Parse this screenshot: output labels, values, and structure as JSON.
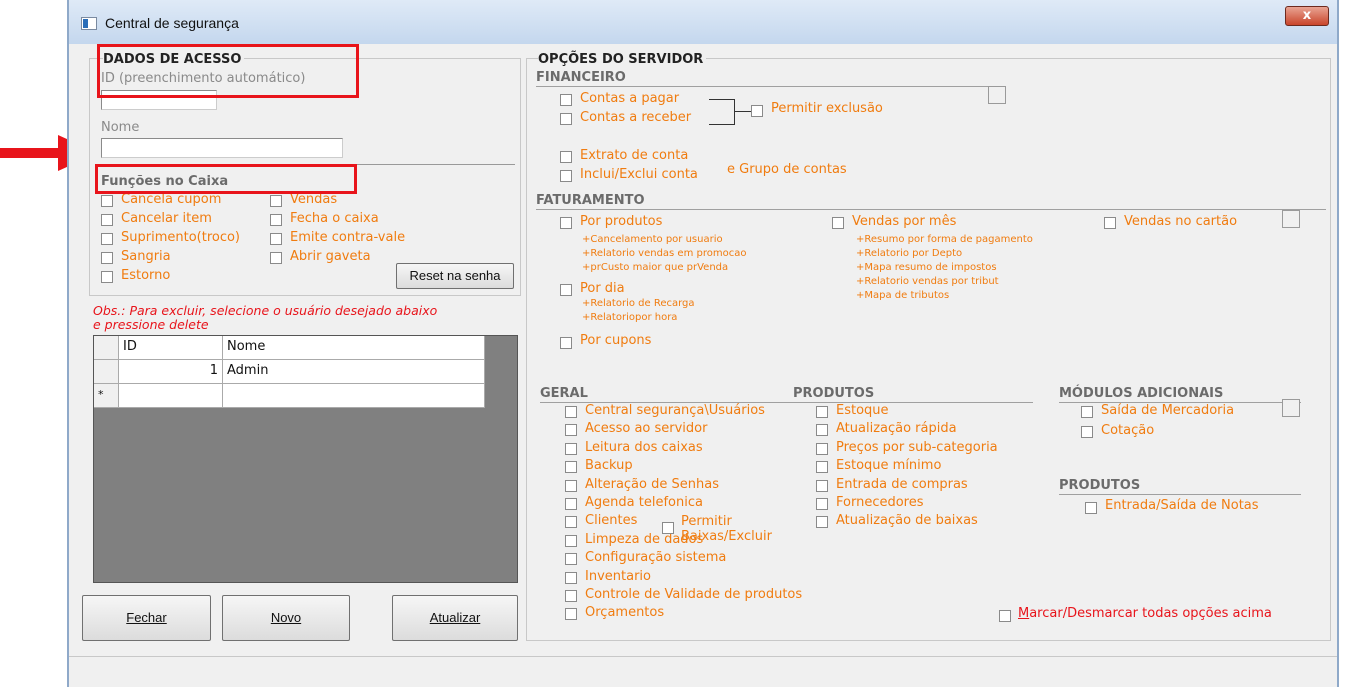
{
  "window": {
    "title": "Central de segurança",
    "close_label": "x"
  },
  "access": {
    "header": "DADOS DE ACESSO",
    "id_label": "ID (preenchimento automático)",
    "id_value": "",
    "name_label": "Nome",
    "name_value": "",
    "funcs_header": "Funções no Caixa",
    "left_items": [
      "Cancela cupom",
      "Cancelar item",
      "Suprimento(troco)",
      "Sangria",
      "Estorno"
    ],
    "right_items": [
      "Vendas",
      "Fecha o caixa",
      "Emite contra-vale",
      "Abrir gaveta"
    ],
    "reset_button": "Reset na senha",
    "obs_text_1": "Obs.: Para excluir, selecione o usuário desejado abaixo",
    "obs_text_2": "e pressione delete"
  },
  "users_table": {
    "columns": [
      "ID",
      "Nome"
    ],
    "rows": [
      {
        "id": "1",
        "nome": "Admin"
      }
    ],
    "new_row_marker": "*"
  },
  "buttons": {
    "close": "Fechar",
    "new": "Novo",
    "update": "Atualizar"
  },
  "server": {
    "header": "OPÇÕES DO SERVIDOR",
    "financeiro": {
      "title": "FINANCEIRO",
      "pagar": "Contas a pagar",
      "receber": "Contas a receber",
      "permitir": "Permitir exclusão",
      "extrato": "Extrato de conta",
      "inclui": "Inclui/Exclui conta",
      "grupo": "e Grupo de contas"
    },
    "faturamento": {
      "title": "FATURAMENTO",
      "por_produtos": "Por produtos",
      "por_produtos_sub": [
        "+Cancelamento por usuario",
        "+Relatorio vendas em promocao",
        "+prCusto maior que prVenda"
      ],
      "por_dia": "Por dia",
      "por_dia_sub": [
        "+Relatorio de Recarga",
        "+Relatoriopor hora"
      ],
      "por_cupons": "Por cupons",
      "vendas_mes": "Vendas por mês",
      "vendas_mes_sub": [
        "+Resumo por forma de pagamento",
        "+Relatorio por Depto",
        "+Mapa resumo de impostos",
        "+Relatorio vendas por tribut",
        "+Mapa de tributos"
      ],
      "vendas_cartao": "Vendas no cartão"
    },
    "geral": {
      "title": "GERAL",
      "items": [
        "Central segurança\\Usuários",
        "Acesso ao servidor",
        "Leitura dos caixas",
        "Backup",
        "Alteração de Senhas",
        "Agenda telefonica",
        "Clientes",
        "Limpeza de dados",
        "Configuração sistema",
        "Inventario",
        "Controle de Validade de produtos",
        "Orçamentos"
      ],
      "permitir_1": "Permitir",
      "permitir_2": "Baixas/Excluir"
    },
    "produtos": {
      "title": "PRODUTOS",
      "items": [
        "Estoque",
        "Atualização rápida",
        "Preços por sub-categoria",
        "Estoque mínimo",
        "Entrada de compras",
        "Fornecedores",
        "Atualização de baixas"
      ]
    },
    "modulos": {
      "title": "MÓDULOS ADICIONAIS",
      "items": [
        "Saída de Mercadoria",
        "Cotação"
      ]
    },
    "produtos2": {
      "title": "PRODUTOS",
      "items": [
        "Entrada/Saída de Notas"
      ]
    },
    "marcar": "Marcar/Desmarcar todas opções acima"
  }
}
